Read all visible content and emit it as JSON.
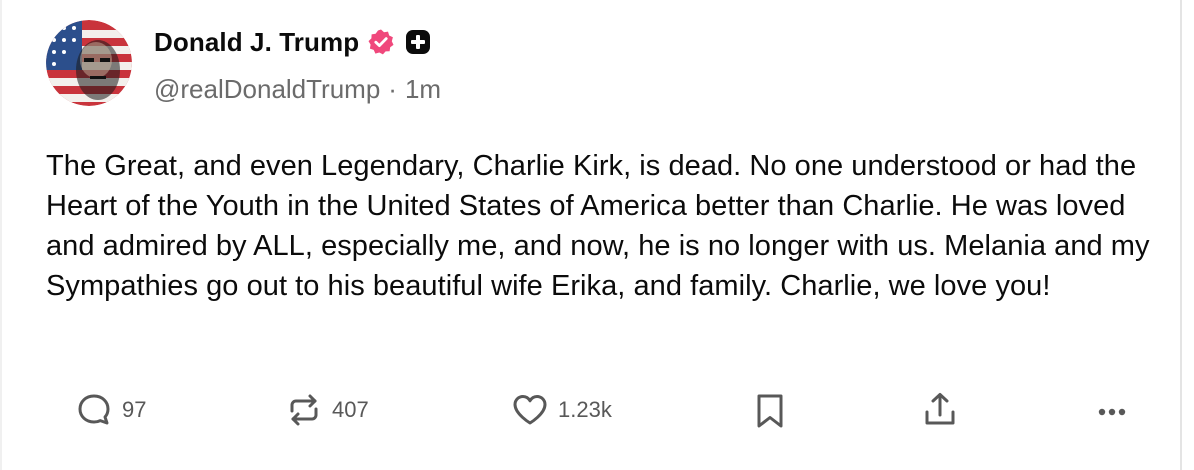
{
  "author": {
    "display_name": "Donald J. Trump",
    "handle": "@realDonaldTrump",
    "separator": "·",
    "time": "1m",
    "verified_badge_color": "#f0487c",
    "avatar_icon": "american-flag-portrait"
  },
  "post": {
    "text": "The Great, and even Legendary, Charlie Kirk, is dead. No one understood or had the Heart of the Youth in the United States of America better than Charlie. He was loved and admired by ALL, especially me, and now, he is no longer with us. Melania and my Sympathies go out to his beautiful wife Erika, and family. Charlie, we love you!"
  },
  "actions": {
    "replies": "97",
    "reposts": "407",
    "likes": "1.23k"
  },
  "icons": {
    "reply": "speech-bubble-icon",
    "repost": "repost-arrows-icon",
    "like": "heart-icon",
    "bookmark": "bookmark-icon",
    "share": "share-upload-icon",
    "more": "ellipsis-icon"
  }
}
